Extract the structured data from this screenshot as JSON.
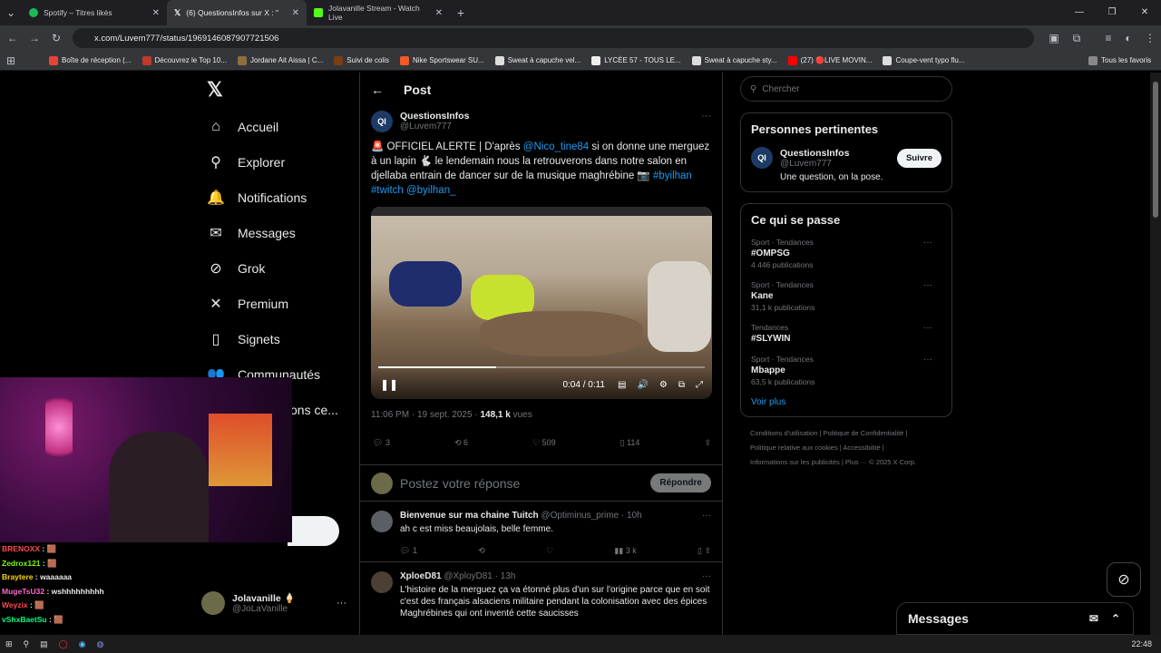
{
  "browser": {
    "tabs": [
      {
        "label": "Spotify – Titres likés",
        "color": "#1db954"
      },
      {
        "label": "(6) QuestionsInfos sur X : \"",
        "color": "#000000"
      },
      {
        "label": "Jolavanille Stream - Watch Live",
        "color": "#53fc18"
      }
    ],
    "url": "x.com/Luvem777/status/1969146087907721506",
    "bookmarks": [
      "Boîte de réception (...",
      "Découvrez le Top 10...",
      "Jordane Ait Aissa | C...",
      "Suivi de colis",
      "Nike Sportswear SU...",
      "Sweat à capuche vel...",
      "LYCÉE 57 - TOUS LE...",
      "Sweat à capuche sty...",
      "(27) 🔴LIVE MOVIN...",
      "Coupe-vent typo flu..."
    ],
    "bookmarks_all": "Tous les favoris"
  },
  "nav": {
    "items": [
      {
        "label": "Accueil",
        "icon": "⌂"
      },
      {
        "label": "Explorer",
        "icon": "⚲"
      },
      {
        "label": "Notifications",
        "icon": "🔔"
      },
      {
        "label": "Messages",
        "icon": "✉"
      },
      {
        "label": "Grok",
        "icon": "⊘"
      },
      {
        "label": "Premium",
        "icon": "✕"
      },
      {
        "label": "Signets",
        "icon": "▯"
      },
      {
        "label": "Communautés",
        "icon": "👥"
      }
    ],
    "more_label": "ons ce...",
    "profile_name": "Jolavanille 🍦",
    "profile_handle": "@JoLaVanille"
  },
  "post": {
    "header": "Post",
    "author_name": "QuestionsInfos",
    "author_handle": "@Luvem777",
    "text_1": "🚨 OFFICIEL ALERTE | D'après ",
    "mention_1": "@Nico_tine84",
    "text_2": " si on donne une merguez à un lapin 🐇 le lendemain nous la retrouverons dans notre salon en djellaba entrain de dancer sur de la musique maghrébine 📷",
    "hashtags": "#byilhan #twitch @byilhan_",
    "video_time": "0:04 / 0:11",
    "video_progress": 0.36,
    "timestamp": "11:06 PM · 19 sept. 2025 · ",
    "views": "148,1 k",
    "views_label": " vues",
    "replies": "3",
    "reposts": "6",
    "likes": "509",
    "bookmarks": "114",
    "reply_placeholder": "Postez votre réponse",
    "reply_button": "Répondre"
  },
  "replies": [
    {
      "name": "Bienvenue sur ma chaine Tuitch",
      "meta": "@Optiminus_prime · 10h",
      "text": "ah c est miss beaujolais, belle femme.",
      "reply_count": "1",
      "views": "3 k"
    },
    {
      "name": "XploeD81",
      "meta": "@XployD81 · 13h",
      "text": "L'histoire de la merguez ça va étonné plus d'un sur l'origine parce que en soit c'est des français alsaciens militaire pendant la colonisation avec des épices Maghrébines qui ont inventé cette saucisses"
    }
  ],
  "right": {
    "search_placeholder": "Chercher",
    "relevant_title": "Personnes pertinentes",
    "rel_name": "QuestionsInfos",
    "rel_handle": "@Luvem777",
    "rel_bio": "Une question, on la pose.",
    "follow_label": "Suivre",
    "trends_title": "Ce qui se passe",
    "trends": [
      {
        "cat": "Sport · Tendances",
        "name": "#OMPSG",
        "count": "4 446 publications"
      },
      {
        "cat": "Sport · Tendances",
        "name": "Kane",
        "count": "31,1 k publications"
      },
      {
        "cat": "Tendances",
        "name": "#SLYWIN",
        "count": ""
      },
      {
        "cat": "Sport · Tendances",
        "name": "Mbappe",
        "count": "63,5 k publications"
      }
    ],
    "see_more": "Voir plus",
    "footer_1": "Conditions d'utilisation   |   Politique de Confidentialité   |",
    "footer_2": "Politique relative aux cookies   |   Accessibilité   |",
    "footer_3": "Informations sur les publicités   |   Plus ···   © 2025 X Corp."
  },
  "chat": [
    {
      "user": "BRENOXX",
      "msg": "🟫",
      "color": "#ff4b4b"
    },
    {
      "user": "Zedrox121",
      "msg": "🟫",
      "color": "#7cfc00"
    },
    {
      "user": "Braytere",
      "msg": "waaaaaa",
      "color": "#ffd700"
    },
    {
      "user": "MugeTsU32",
      "msg": "wshhhhhhhhh",
      "color": "#ff66cc"
    },
    {
      "user": "Weyzix",
      "msg": "🟫",
      "color": "#ff4b4b"
    },
    {
      "user": "vShxBaetSu",
      "msg": "🟫",
      "color": "#00ff7f"
    }
  ],
  "messages_dock": "Messages",
  "taskbar_time": "22:48"
}
